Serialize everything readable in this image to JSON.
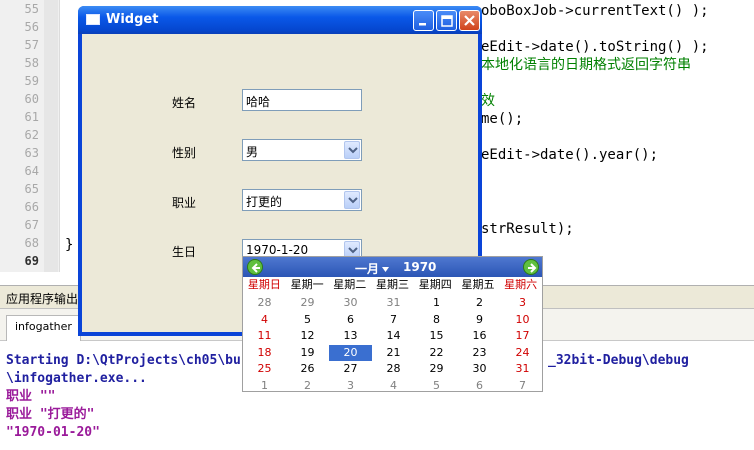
{
  "editor": {
    "line_numbers": [
      "55",
      "56",
      "57",
      "58",
      "59",
      "60",
      "61",
      "62",
      "63",
      "64",
      "65",
      "66",
      "67",
      "68",
      "69"
    ],
    "code_fragments": [
      {
        "text": "oboBoxJob->currentText() );",
        "kind": "code"
      },
      {
        "text": "eEdit->date().toString() );",
        "kind": "code"
      },
      {
        "text": "本地化语言的日期格式返回字符串",
        "kind": "comment"
      },
      {
        "text": "效",
        "kind": "comment"
      },
      {
        "text": "me();",
        "kind": "code"
      },
      {
        "text": "eEdit->date().year();",
        "kind": "code"
      },
      {
        "text": "strResult);",
        "kind": "code"
      },
      {
        "text": "}",
        "kind": "code"
      }
    ]
  },
  "output": {
    "pane_title": "应用程序输出",
    "tab_label": "infogather",
    "lines": [
      {
        "text": "Starting D:\\QtProjects\\ch05\\bu",
        "color": "#2020a0"
      },
      {
        "text": "_32bit-Debug\\debug",
        "color": "#2020a0"
      },
      {
        "text": "\\infogather.exe...",
        "color": "#2020a0"
      },
      {
        "text": "职业 \"\"",
        "color": "#9a1a9a"
      },
      {
        "text": "职业 \"打更的\"",
        "color": "#9a1a9a"
      },
      {
        "text": "\"1970-01-20\"",
        "color": "#9a1a9a"
      }
    ]
  },
  "window": {
    "title": "Widget",
    "buttons": {
      "minimize": "minimize-icon",
      "maximize": "maximize-icon",
      "close": "close-icon"
    }
  },
  "form": {
    "name_label": "姓名",
    "name_value": "哈哈",
    "gender_label": "性别",
    "gender_value": "男",
    "job_label": "职业",
    "job_value": "打更的",
    "birthday_label": "生日",
    "birthday_value": "1970-1-20"
  },
  "calendar": {
    "month": "一月",
    "year": "1970",
    "weekdays": [
      "星期日",
      "星期一",
      "星期二",
      "星期三",
      "星期四",
      "星期五",
      "星期六"
    ],
    "weeks": [
      [
        "28",
        "29",
        "30",
        "31",
        "1",
        "2",
        "3"
      ],
      [
        "4",
        "5",
        "6",
        "7",
        "8",
        "9",
        "10"
      ],
      [
        "11",
        "12",
        "13",
        "14",
        "15",
        "16",
        "17"
      ],
      [
        "18",
        "19",
        "20",
        "21",
        "22",
        "23",
        "24"
      ],
      [
        "25",
        "26",
        "27",
        "28",
        "29",
        "30",
        "31"
      ],
      [
        "1",
        "2",
        "3",
        "4",
        "5",
        "6",
        "7"
      ]
    ],
    "selected_day": "20",
    "colors": {
      "header": "#2b55b5",
      "weekend": "#d00000",
      "selected": "#3a6fd0",
      "nav_arrow": "#5fbf3f"
    }
  }
}
